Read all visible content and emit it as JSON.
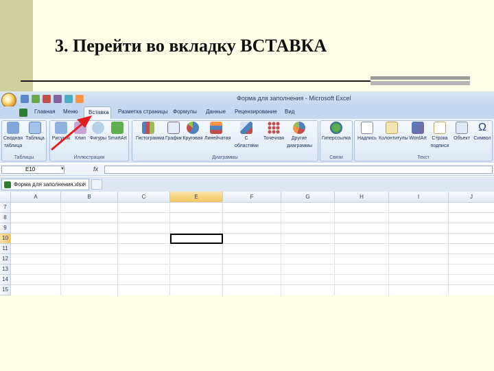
{
  "slide": {
    "title": "3. Перейти во вкладку ВСТАВКА"
  },
  "window": {
    "title": "Форма для заполнения - Microsoft Excel"
  },
  "tabs": [
    "Главная",
    "Меню",
    "Вставка",
    "Разметка страницы",
    "Формулы",
    "Данные",
    "Рецензирование",
    "Вид"
  ],
  "ribbon": {
    "groups": {
      "tables": "Таблицы",
      "illustrations": "Иллюстрации",
      "charts": "Диаграммы",
      "links": "Связи",
      "text": "Текст"
    },
    "buttons": {
      "pivot_line1": "Сводная",
      "pivot_line2": "таблица",
      "table": "Таблица",
      "picture": "Рисунок",
      "clip": "Клип",
      "shapes": "Фигуры",
      "smartart": "SmartArt",
      "column": "Гистограмма",
      "line": "График",
      "pie": "Круговая",
      "bar": "Линейчатая",
      "area_line1": "С",
      "area_line2": "областями",
      "scatter": "Точечная",
      "other_line1": "Другие",
      "other_line2": "диаграммы",
      "hyperlink": "Гиперссылка",
      "textbox": "Надпись",
      "header": "Колонтитулы",
      "wordart": "WordArt",
      "sigline_line1": "Строка",
      "sigline_line2": "подписи",
      "object": "Объект",
      "symbol": "Символ"
    }
  },
  "formula_bar": {
    "name_box": "E10",
    "fx": "fx",
    "formula": ""
  },
  "document_tab": {
    "label": "Форма для заполнения.xlsx"
  },
  "grid": {
    "columns": [
      "A",
      "B",
      "C",
      "E",
      "F",
      "G",
      "H",
      "I",
      "J"
    ],
    "rows": [
      "7",
      "8",
      "9",
      "10",
      "11",
      "12",
      "13",
      "14",
      "15"
    ],
    "selected_cell": "E10"
  },
  "colors": {
    "ribbon_tab_bg": "#c5d8ef",
    "active_header": "#f5c766",
    "arrow": "#e02020"
  }
}
